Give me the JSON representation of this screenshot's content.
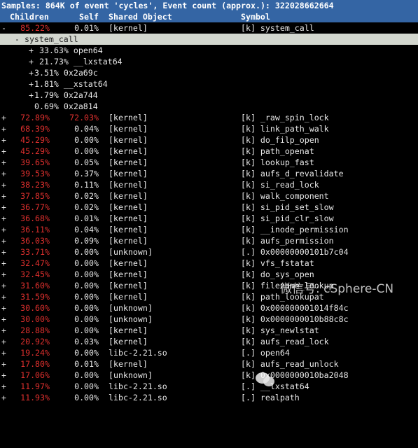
{
  "header": {
    "title": "Samples: 864K of event 'cycles', Event count (approx.): 322028662664"
  },
  "columns": {
    "children": "Children",
    "self": "Self",
    "shared_object": "Shared Object",
    "symbol": "Symbol"
  },
  "colors": {
    "header_bg": "#3465a4",
    "highlight": "#e0302e",
    "selected_bg": "#d3d7cf"
  },
  "top_entry": {
    "expander": "-",
    "children": "85.22%",
    "self": "0.01%",
    "shared_object": "[kernel]",
    "symbol": "[k] system_call"
  },
  "callgraph": {
    "root": "- system_call",
    "items": [
      {
        "expander": "+",
        "text": "33.63% open64"
      },
      {
        "expander": "+",
        "text": "21.73% __lxstat64"
      },
      {
        "expander": "+",
        "text": "3.51% 0x2a69c"
      },
      {
        "expander": "+",
        "text": "1.81% __xstat64"
      },
      {
        "expander": "+",
        "text": "1.79% 0x2a744"
      },
      {
        "expander": "",
        "text": "0.69% 0x2a814"
      }
    ]
  },
  "rows": [
    {
      "expander": "+",
      "children": "72.89%",
      "self": "72.03%",
      "self_red": true,
      "shared_object": "[kernel]",
      "symbol": "[k] _raw_spin_lock"
    },
    {
      "expander": "+",
      "children": "68.39%",
      "self": "0.04%",
      "shared_object": "[kernel]",
      "symbol": "[k] link_path_walk"
    },
    {
      "expander": "+",
      "children": "45.29%",
      "self": "0.00%",
      "shared_object": "[kernel]",
      "symbol": "[k] do_filp_open"
    },
    {
      "expander": "+",
      "children": "45.29%",
      "self": "0.00%",
      "shared_object": "[kernel]",
      "symbol": "[k] path_openat"
    },
    {
      "expander": "+",
      "children": "39.65%",
      "self": "0.05%",
      "shared_object": "[kernel]",
      "symbol": "[k] lookup_fast"
    },
    {
      "expander": "+",
      "children": "39.53%",
      "self": "0.37%",
      "shared_object": "[kernel]",
      "symbol": "[k] aufs_d_revalidate"
    },
    {
      "expander": "+",
      "children": "38.23%",
      "self": "0.11%",
      "shared_object": "[kernel]",
      "symbol": "[k] si_read_lock"
    },
    {
      "expander": "+",
      "children": "37.85%",
      "self": "0.02%",
      "shared_object": "[kernel]",
      "symbol": "[k] walk_component"
    },
    {
      "expander": "+",
      "children": "36.77%",
      "self": "0.02%",
      "shared_object": "[kernel]",
      "symbol": "[k] si_pid_set_slow"
    },
    {
      "expander": "+",
      "children": "36.68%",
      "self": "0.01%",
      "shared_object": "[kernel]",
      "symbol": "[k] si_pid_clr_slow"
    },
    {
      "expander": "+",
      "children": "36.11%",
      "self": "0.04%",
      "shared_object": "[kernel]",
      "symbol": "[k] __inode_permission"
    },
    {
      "expander": "+",
      "children": "36.03%",
      "self": "0.09%",
      "shared_object": "[kernel]",
      "symbol": "[k] aufs_permission"
    },
    {
      "expander": "+",
      "children": "33.71%",
      "self": "0.00%",
      "shared_object": "[unknown]",
      "symbol": "[.] 0x00000000101b7c04"
    },
    {
      "expander": "+",
      "children": "32.47%",
      "self": "0.00%",
      "shared_object": "[kernel]",
      "symbol": "[k] vfs_fstatat"
    },
    {
      "expander": "+",
      "children": "32.45%",
      "self": "0.00%",
      "shared_object": "[kernel]",
      "symbol": "[k] do_sys_open"
    },
    {
      "expander": "+",
      "children": "31.60%",
      "self": "0.00%",
      "shared_object": "[kernel]",
      "symbol": "[k] filename_lookup"
    },
    {
      "expander": "+",
      "children": "31.59%",
      "self": "0.00%",
      "shared_object": "[kernel]",
      "symbol": "[k] path_lookupat"
    },
    {
      "expander": "+",
      "children": "30.60%",
      "self": "0.00%",
      "shared_object": "[unknown]",
      "symbol": "[k] 0x000000001014f84c"
    },
    {
      "expander": "+",
      "children": "30.00%",
      "self": "0.00%",
      "shared_object": "[unknown]",
      "symbol": "[k] 0x0000000010b88c8c"
    },
    {
      "expander": "+",
      "children": "28.88%",
      "self": "0.00%",
      "shared_object": "[kernel]",
      "symbol": "[k] sys_newlstat"
    },
    {
      "expander": "+",
      "children": "20.92%",
      "self": "0.03%",
      "shared_object": "[kernel]",
      "symbol": "[k] aufs_read_lock"
    },
    {
      "expander": "+",
      "children": "19.24%",
      "self": "0.00%",
      "shared_object": "libc-2.21.so",
      "symbol": "[.] open64"
    },
    {
      "expander": "+",
      "children": "17.80%",
      "self": "0.01%",
      "shared_object": "[kernel]",
      "symbol": "[k] aufs_read_unlock"
    },
    {
      "expander": "+",
      "children": "17.06%",
      "self": "0.00%",
      "shared_object": "[unknown]",
      "symbol": "[k] 0x0000000010ba2048"
    },
    {
      "expander": "+",
      "children": "11.97%",
      "self": "0.00%",
      "shared_object": "libc-2.21.so",
      "symbol": "[.] __lxstat64"
    },
    {
      "expander": "+",
      "children": "11.93%",
      "self": "0.00%",
      "shared_object": "libc-2.21.so",
      "symbol": "[.] realpath"
    }
  ],
  "watermark": "微信号: cSphere-CN"
}
